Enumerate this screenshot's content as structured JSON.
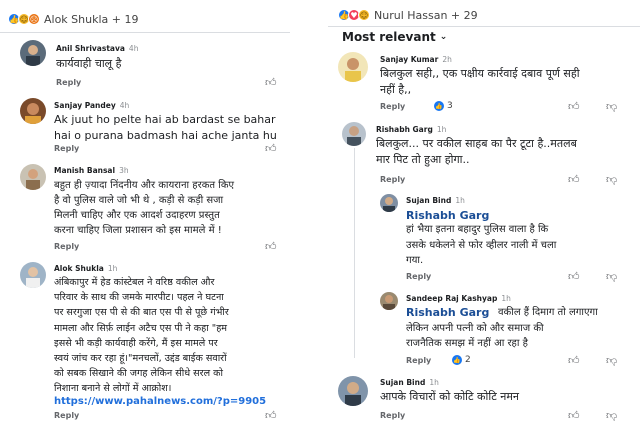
{
  "left": {
    "reaction_summary": "Alok Shukla + 19",
    "comments": [
      {
        "author": "Anil Shrivastava",
        "time": "4h",
        "text": "कार्यवाही चालू है",
        "reply": "Reply"
      },
      {
        "author": "Sanjay Pandey",
        "time": "4h",
        "text": "Ak juut ho pelte hai ab bardast se bahar\nhai o purana badmash hai ache janta hu",
        "reply": "Reply"
      },
      {
        "author": "Manish Bansal",
        "time": "3h",
        "text": "बहुत ही ज़्यादा निंदनीय और कायराना हरकत किए\nहै वो पुलिस वाले जो भी थे , कड़ी से कड़ी सजा\nमिलनी चाहिए और एक आदर्श उदाहरण प्रस्तुत\nकरना चाहिए जिला प्रशासन को इस मामले में !",
        "reply": "Reply"
      },
      {
        "author": "Alok Shukla",
        "time": "1h",
        "text": "अंबिकापुर में हेड कांस्टेबल ने वरिष्ठ वकील और\nपरिवार के साथ की जमके मारपीट। पहल ने घटना\nपर सरगुजा एस पी से की बात एस पी से पूछे गंभीर\nमामला और सिर्फ़ लाईन अटैच एस पी ने कहा \"हम\nइससे भी कड़ी कार्यवाही करेंगे, मैं इस मामले पर\nस्वयं जांच कर रहा हूं।\"मनचलों, उद्दंड बाईक सवारों\nको सबक सिखाने की जगह लेकिन सीधे सरल को\nनिशाना बनाने से लोगों में आक्रोश।",
        "link": "https://www.pahalnews.com/?p=9905",
        "reply": "Reply"
      }
    ]
  },
  "right": {
    "reaction_summary": "Nurul Hassan + 29",
    "sort_label": "Most relevant",
    "comments": [
      {
        "author": "Sanjay Kumar",
        "time": "2h",
        "text": "बिलकुल सही,, एक पक्षीय कार्रवाई दबाव पूर्ण सही\nनहीं है,,",
        "reply": "Reply",
        "likes": "3"
      },
      {
        "author": "Rishabh Garg",
        "time": "1h",
        "text": "बिलकुल... पर वकील साहब का पैर टूटा है..मतलब\nमार पिट तो हुआ होगा..",
        "reply": "Reply"
      },
      {
        "author": "Sujan Bind",
        "time": "1h",
        "mention": "Rishabh Garg",
        "text": "हां भैया इतना बहादुर पुलिस वाला है कि\nउसके धकेलने से फोर व्हीलर नाली में चला\nगया.",
        "reply": "Reply"
      },
      {
        "author": "Sandeep Raj Kashyap",
        "time": "1h",
        "mention": "Rishabh Garg",
        "text": "वकील हैं दिमाग तो लगाएगा\nलेकिन अपनी पत्नी को और समाज की\nराजनैतिक समझ में नहीं आ रहा है",
        "reply": "Reply",
        "likes": "2"
      },
      {
        "author": "Sujan Bind",
        "time": "1h",
        "text": "आपके विचारों को कोटि कोटि नमन",
        "reply": "Reply"
      }
    ]
  },
  "icons": {
    "like": "thumbs-up-icon",
    "dislike": "thumbs-down-icon",
    "chevron": "chevron-down-icon"
  },
  "colors": {
    "brand": "#1877f2",
    "mention": "#1b4e96",
    "link": "#216fdb"
  }
}
